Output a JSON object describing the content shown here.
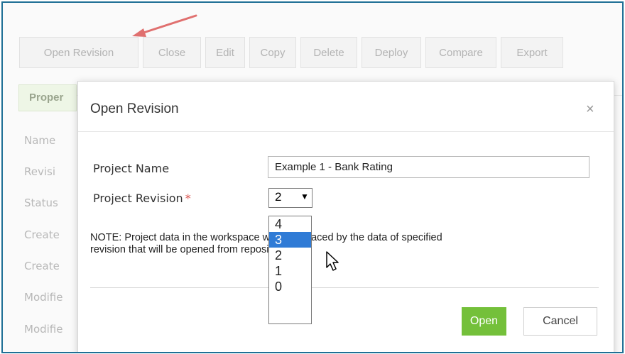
{
  "toolbar": {
    "buttons": [
      "Open Revision",
      "Close",
      "Edit",
      "Copy",
      "Delete",
      "Deploy",
      "Compare",
      "Export"
    ]
  },
  "background": {
    "tab_label": "Proper",
    "fields": [
      "Name",
      "Revisi",
      "Status",
      "Create",
      "Create",
      "Modifie",
      "Modifie"
    ]
  },
  "modal": {
    "title": "Open Revision",
    "close_glyph": "×",
    "project_name_label": "Project Name",
    "project_name_value": "Example 1 - Bank Rating",
    "project_revision_label": "Project Revision",
    "required_marker": "*",
    "selected_revision": "2",
    "select_caret": "▼",
    "revision_options": [
      "4",
      "3",
      "2",
      "1",
      "0"
    ],
    "highlighted_option": "3",
    "note_line1": "NOTE: Project data in the workspace will be replaced by the data of specified",
    "note_line2": "revision that will be opened from repository.",
    "open_button": "Open",
    "cancel_button": "Cancel"
  },
  "colors": {
    "accent_green": "#74c03a",
    "selection_blue": "#2f7bd6",
    "frame_border": "#1f6f95",
    "annotation_arrow": "#e0706f"
  }
}
